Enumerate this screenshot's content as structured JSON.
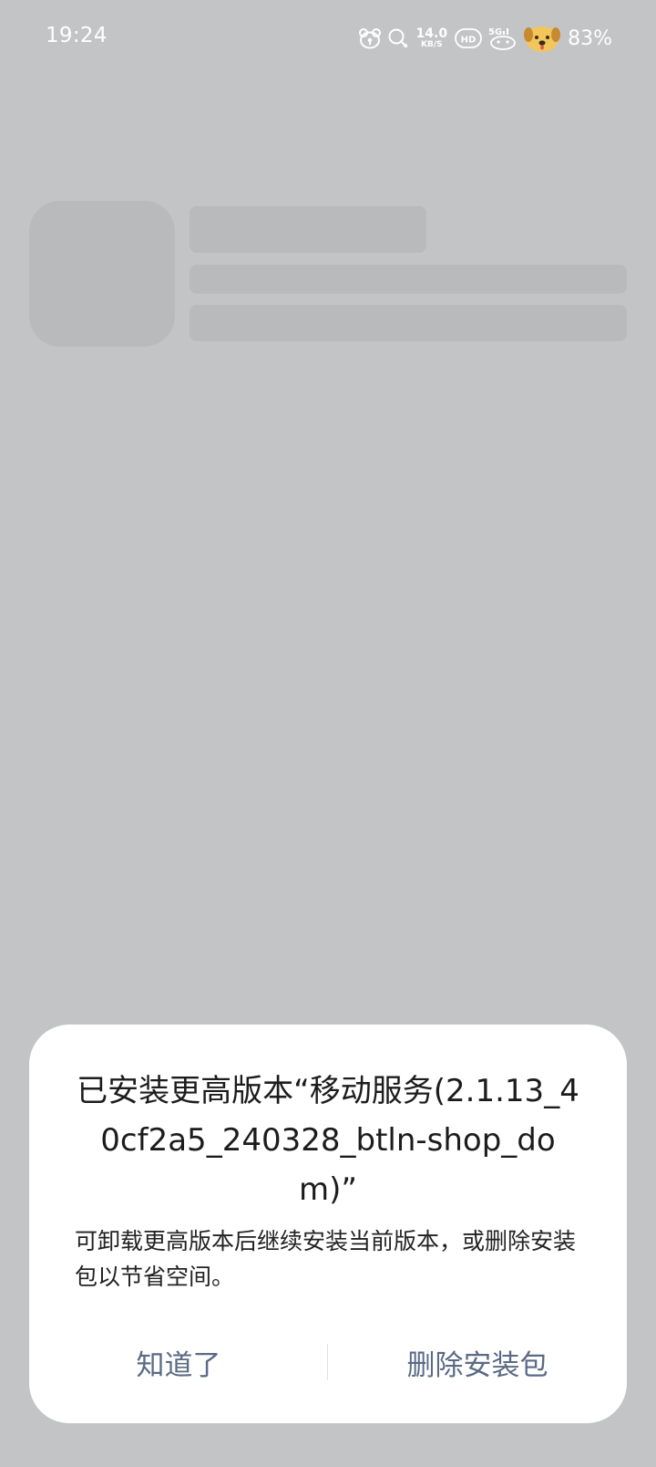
{
  "status_bar": {
    "time": "19:24",
    "net_speed_value": "14.0",
    "net_speed_unit": "KB/S",
    "hd_badge": "HD",
    "network_type": "5G",
    "battery_percent": "83%",
    "icons": [
      "notification-bear-icon",
      "chat-bubble-icon",
      "hd-voice-icon",
      "signal-5g-icon",
      "dog-mascot-battery-icon"
    ]
  },
  "dialog": {
    "title": "已安装更高版本“移动服务(2.1.13_40cf2a5_240328_btln-shop_dom)”",
    "message": "可卸载更高版本后继续安装当前版本，或删除安装包以节省空间。",
    "buttons": {
      "ok_label": "知道了",
      "delete_label": "删除安装包"
    }
  },
  "colors": {
    "background": "#c3c4c6",
    "skeleton": "#b9babc",
    "dialog_bg": "#ffffff",
    "button_text": "#5a6a85"
  }
}
